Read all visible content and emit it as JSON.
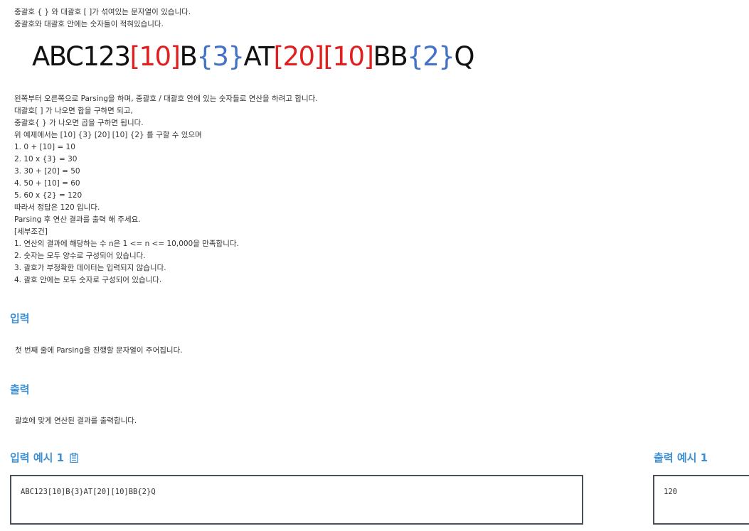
{
  "intro": [
    "중괄호 { } 와 대괄호 [ ]가 섞여있는 문자열이 있습니다.",
    "중괄호와 대괄호 안에는 숫자들이 적혀있습니다."
  ],
  "display_string": [
    {
      "text": "ABC123",
      "kind": "plain"
    },
    {
      "text": "[10]",
      "kind": "square"
    },
    {
      "text": "B",
      "kind": "plain"
    },
    {
      "text": "{3}",
      "kind": "curly"
    },
    {
      "text": "AT",
      "kind": "plain"
    },
    {
      "text": "[20]",
      "kind": "square"
    },
    {
      "text": "[10]",
      "kind": "square"
    },
    {
      "text": "BB",
      "kind": "plain"
    },
    {
      "text": "{2}",
      "kind": "curly"
    },
    {
      "text": "Q",
      "kind": "plain"
    }
  ],
  "colors": {
    "plain": "#111111",
    "square": "#e02020",
    "curly": "#4472c4",
    "heading": "#3d8fd1"
  },
  "description": [
    "왼쪽부터 오른쪽으로 Parsing을 하며, 중괄호 / 대괄호 안에 있는 숫자들로 연산을 하려고 합니다.",
    "대괄호[ ] 가 나오면 합을 구하면 되고,",
    "중괄호{ } 가 나오면 곱을 구하면 됩니다.",
    "위 예제에서는 [10] {3} [20] [10] {2} 를 구할 수 있으며",
    "1. 0 + [10] = 10",
    "2. 10 x {3} = 30",
    "3. 30 + [20] = 50",
    "4. 50 + [10] = 60",
    "5. 60 x {2} = 120",
    "따라서 정답은 120 입니다.",
    "Parsing 후 연산 결과를 출력 해 주세요.",
    "[세부조건]",
    "1. 연산의 결과에 해당하는 수 n은 1 <= n <= 10,000을 만족합니다.",
    "2. 숫자는 모두 양수로 구성되어 있습니다.",
    "3. 괄호가 부정확한 데이터는 입력되지 않습니다.",
    "4. 괄호 안에는 모두 숫자로 구성되어 있습니다."
  ],
  "input_section": {
    "title": "입력",
    "text": "첫 번째 줄에 Parsing을 진행할 문자열이 주어집니다."
  },
  "output_section": {
    "title": "출력",
    "text": "괄호에 맞게 연산된 결과를 출력합니다."
  },
  "input_example": {
    "title": "입력 예시 1",
    "copy_icon": "clipboard-icon",
    "content": "ABC123[10]B{3}AT[20][10]BB{2}Q"
  },
  "output_example": {
    "title": "출력 예시 1",
    "content": "120"
  }
}
